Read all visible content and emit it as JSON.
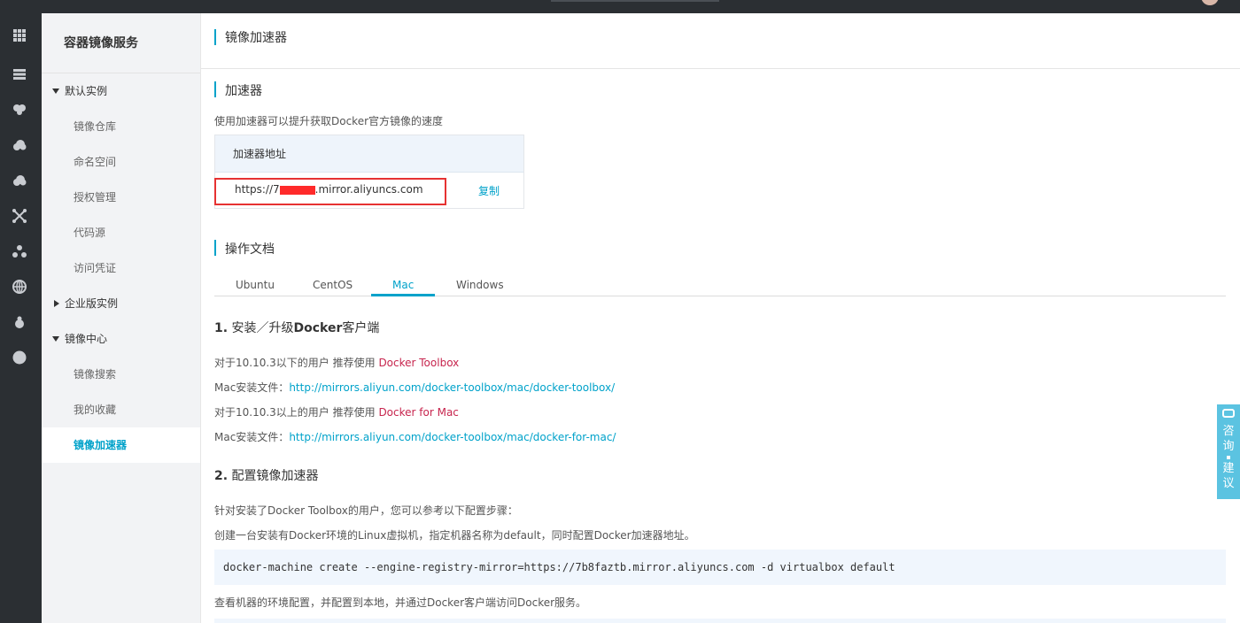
{
  "sidebar": {
    "title": "容器镜像服务",
    "groups": [
      {
        "label": "默认实例",
        "expanded": true
      },
      {
        "label": "企业版实例",
        "expanded": false
      },
      {
        "label": "镜像中心",
        "expanded": true
      }
    ],
    "items": [
      "镜像仓库",
      "命名空间",
      "授权管理",
      "代码源",
      "访问凭证"
    ],
    "center_items": [
      "镜像搜索",
      "我的收藏",
      "镜像加速器"
    ],
    "active_item": "镜像加速器"
  },
  "rail_icons": [
    "grid-icon",
    "server-icon",
    "brain-icon",
    "cloud-icon",
    "cloud-upload-icon",
    "network-icon",
    "cluster-icon",
    "globe-icon",
    "bug-icon",
    "circle-icon"
  ],
  "header": {
    "title": "镜像加速器"
  },
  "accelerator": {
    "section_title": "加速器",
    "description": "使用加速器可以提升获取Docker官方镜像的速度",
    "column_header": "加速器地址",
    "url_prefix": "https://7",
    "url_suffix": ".mirror.aliyuncs.com",
    "copy_label": "复制"
  },
  "docs": {
    "section_title": "操作文档",
    "tabs": [
      "Ubuntu",
      "CentOS",
      "Mac",
      "Windows"
    ],
    "active_tab": "Mac",
    "step1": {
      "num": "1.",
      "title_a": "安装／升级",
      "title_b": "Docker",
      "title_c": "客户端",
      "lines": [
        {
          "text": "对于10.10.3以下的用户 推荐使用 ",
          "link": "Docker Toolbox",
          "link_type": "red"
        },
        {
          "text": "Mac安装文件：",
          "link": "http://mirrors.aliyun.com/docker-toolbox/mac/docker-toolbox/",
          "link_type": "blue"
        },
        {
          "text": "对于10.10.3以上的用户 推荐使用 ",
          "link": "Docker for Mac",
          "link_type": "red"
        },
        {
          "text": "Mac安装文件：",
          "link": "http://mirrors.aliyun.com/docker-toolbox/mac/docker-for-mac/",
          "link_type": "blue"
        }
      ]
    },
    "step2": {
      "num": "2.",
      "title": "配置镜像加速器",
      "line1": "针对安装了Docker Toolbox的用户，您可以参考以下配置步骤：",
      "line2": "创建一台安装有Docker环境的Linux虚拟机，指定机器名称为default，同时配置Docker加速器地址。",
      "code": "docker-machine create --engine-registry-mirror=https://7b8faztb.mirror.aliyuncs.com -d virtualbox default",
      "line3": "查看机器的环境配置，并配置到本地，并通过Docker客户端访问Docker服务。"
    }
  },
  "feedback": {
    "line1": "咨询",
    "line2": "建议"
  },
  "colors": {
    "accent": "#00a2ca",
    "link_red": "#c7254e",
    "highlight_border": "#e63232"
  }
}
